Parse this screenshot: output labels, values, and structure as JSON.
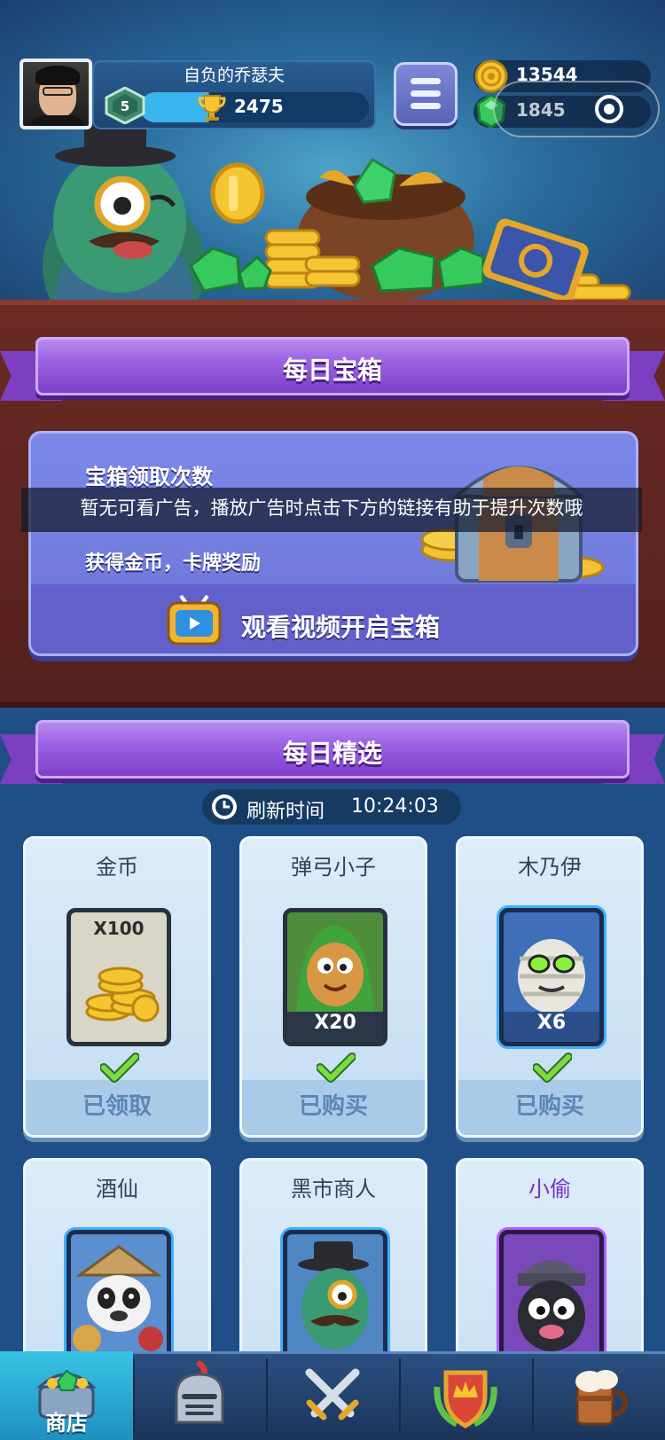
{
  "player": {
    "name": "自负的乔瑟夫",
    "level": "5",
    "trophies": "2475"
  },
  "currency": {
    "gold": "13544",
    "gems": "1845"
  },
  "icons": {
    "menu": "hamburger-menu-icon",
    "gold": "gold-coin-icon",
    "gem": "green-gem-icon",
    "capsule": "target-icon",
    "trophy": "trophy-icon",
    "clock": "clock-icon",
    "check": "checkmark-icon",
    "tv": "tv-icon"
  },
  "daily_chest": {
    "banner": "每日宝箱",
    "title": "宝箱领取次数",
    "ad_notice": "暂无可看广告，播放广告时点击下方的链接有助于提升次数哦",
    "reward": "获得金币，卡牌奖励",
    "watch_button": "观看视频开启宝箱"
  },
  "daily_picks": {
    "banner": "每日精选",
    "refresh_label": "刷新时间",
    "refresh_time": "10:24:03",
    "items": [
      {
        "name": "金币",
        "qty": "X100",
        "status": "已领取"
      },
      {
        "name": "弹弓小子",
        "qty": "X20",
        "status": "已购买"
      },
      {
        "name": "木乃伊",
        "qty": "X6",
        "status": "已购买"
      },
      {
        "name": "酒仙"
      },
      {
        "name": "黑市商人"
      },
      {
        "name": "小偷"
      }
    ]
  },
  "nav": {
    "shop": "商店"
  },
  "colors": {
    "ribbon": "#9c62e2",
    "board": "#6a2a24",
    "card": "#dcecf9",
    "nav_active": "#38c3e6",
    "background": "#1f4f86"
  }
}
